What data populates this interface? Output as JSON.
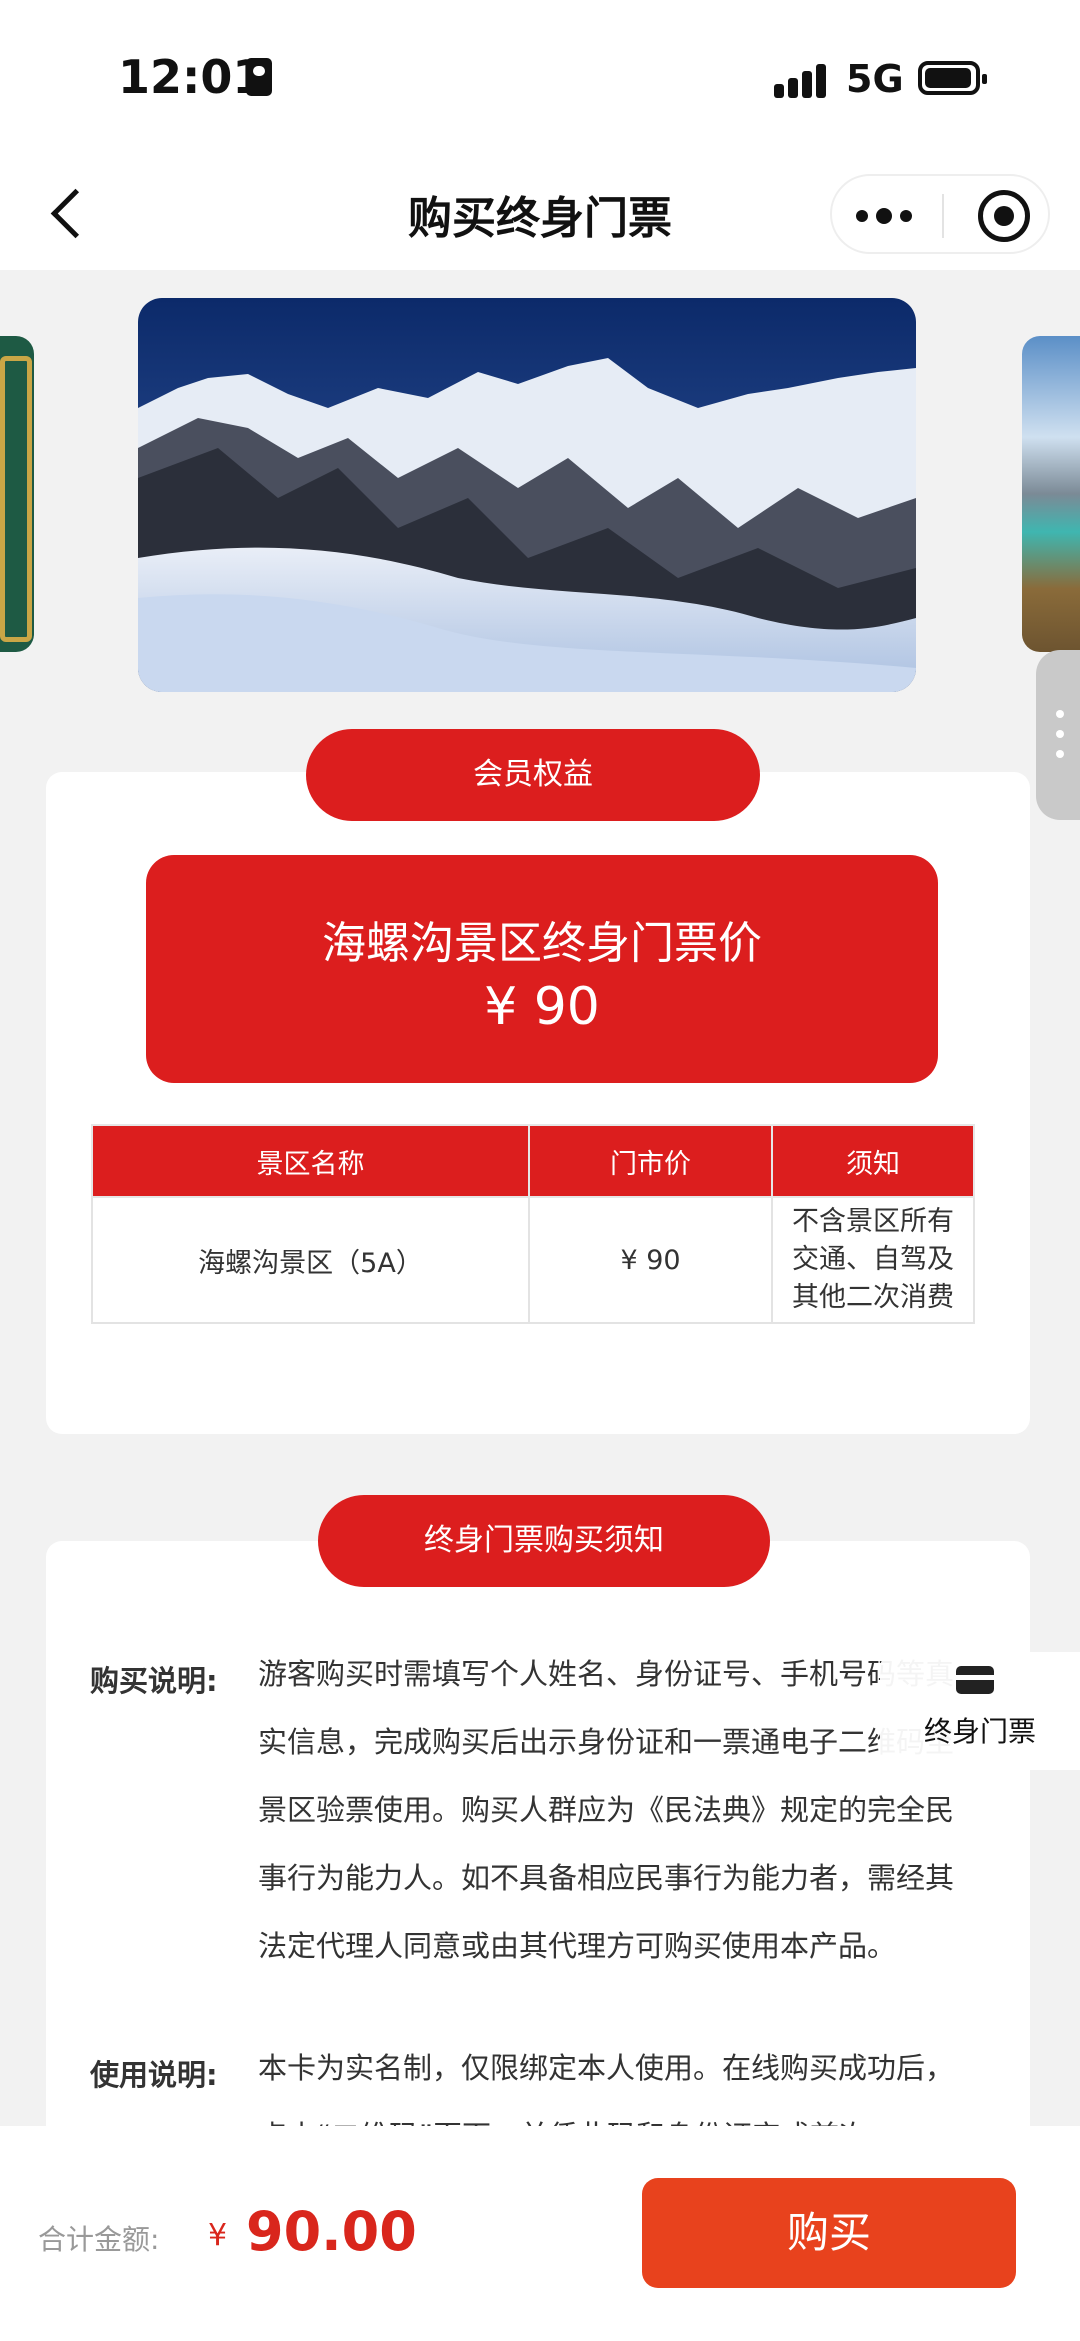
{
  "status_bar": {
    "time": "12:01",
    "network": "5G"
  },
  "nav": {
    "title": "购买终身门票"
  },
  "member_section": {
    "pill": "会员权益",
    "price_title": "海螺沟景区终身门票价",
    "price_value": "¥ 90",
    "table": {
      "headers": [
        "景区名称",
        "门市价",
        "须知"
      ],
      "row": {
        "name": "海螺沟景区（5A）",
        "price": "¥ 90",
        "note": "不含景区所有交通、自驾及其他二次消费"
      }
    }
  },
  "notice_section": {
    "pill": "终身门票购买须知",
    "purchase": {
      "label": "购买说明:",
      "text": "游客购买时需填写个人姓名、身份证号、手机号码等真实信息，完成购买后出示身份证和一票通电子二维码至景区验票使用。购买人群应为《民法典》规定的完全民事行为能力人。如不具备相应民事行为能力者，需经其法定代理人同意或由其代理方可购买使用本产品。"
    },
    "usage": {
      "label": "使用说明:",
      "text": "本卡为实名制，仅限绑定本人使用。在线购买成功后，点击“二维码”页面，并凭此码和身份证完成首次"
    }
  },
  "floating": {
    "label": "终身门票"
  },
  "bottom_bar": {
    "total_label": "合计金额:",
    "currency": "¥",
    "total_amount": "90.00",
    "buy_label": "购买"
  },
  "colors": {
    "accent_red": "#dc1e1e",
    "buy_orange": "#e8421d",
    "price_red": "#d9261c"
  }
}
